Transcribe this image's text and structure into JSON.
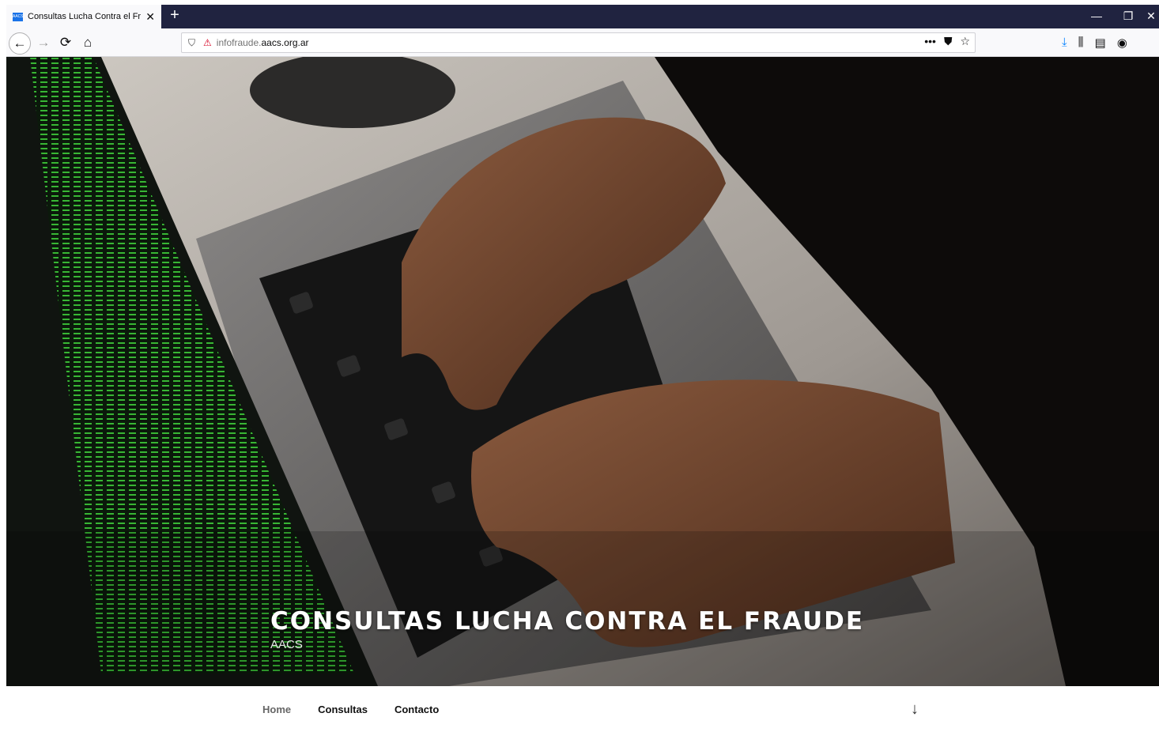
{
  "browser": {
    "tab_title": "Consultas Lucha Contra el Frau",
    "tab_favicon_text": "AACS",
    "new_tab_glyph": "+",
    "url_prefix": "infofraude.",
    "url_domain": "aacs.org.ar",
    "icons": {
      "back": "←",
      "forward": "→",
      "reload": "⟳",
      "home": "⌂",
      "shield": "⛉",
      "insecure": "⚠",
      "more": "•••",
      "pocket": "⛊",
      "star": "☆",
      "download": "⤓",
      "library": "⫼",
      "sidebar": "▤",
      "account": "◉",
      "minimize": "—",
      "restore": "❐",
      "close": "✕"
    }
  },
  "hero": {
    "title": "CONSULTAS LUCHA CONTRA EL FRAUDE",
    "subtitle": "AACS",
    "image_alt": "Hands typing on a laptop keyboard with green code on screen"
  },
  "site_nav": {
    "items": [
      {
        "label": "Home"
      },
      {
        "label": "Consultas"
      },
      {
        "label": "Contacto"
      }
    ],
    "scroll_arrow": "↓"
  }
}
